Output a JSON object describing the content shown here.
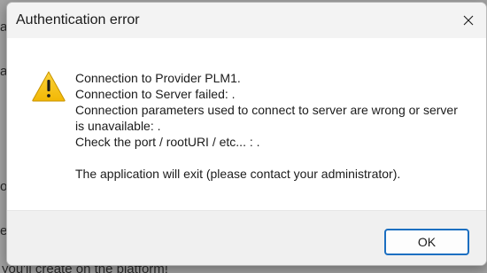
{
  "background": {
    "fragments": [
      "a",
      "a",
      "o",
      "e"
    ],
    "bottom_text": "you'll create on the platform!"
  },
  "dialog": {
    "title": "Authentication error",
    "icon": "warning-icon",
    "message_lines": [
      "Connection to Provider PLM1.",
      "Connection to Server failed: .",
      "Connection parameters used to connect to server are wrong or server is unavailable: .",
      "Check the port / rootURI / etc... : ."
    ],
    "footer_message": "The application will exit (please contact your administrator).",
    "ok_label": "OK",
    "colors": {
      "accent": "#1c6fc1",
      "warning": "#f6c21c"
    }
  }
}
